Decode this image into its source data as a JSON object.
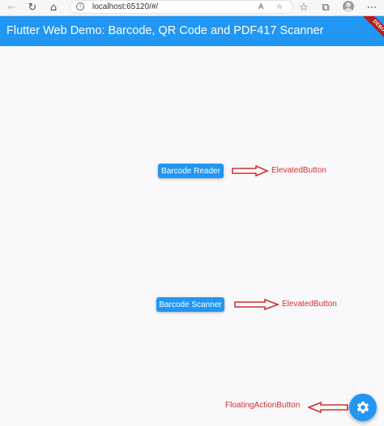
{
  "browser": {
    "back_icon": "←",
    "reload_icon": "↻",
    "home_icon": "⌂",
    "url": "localhost:65120/#/",
    "read_aloud_icon": "A",
    "star_icon": "☆",
    "favorites_icon": "☆",
    "collections_icon": "⧉"
  },
  "app_bar": {
    "title": "Flutter Web Demo: Barcode, QR Code and PDF417 Scanner",
    "debug_banner": "DEBUG",
    "color": "#2196f3"
  },
  "buttons": {
    "barcode_reader": "Barcode Reader",
    "barcode_scanner": "Barcode Scanner"
  },
  "annotations": {
    "reader_label": "ElevatedButton",
    "scanner_label": "ElevatedButton",
    "fab_label": "FloatingActionButton",
    "color": "#d32f2f"
  },
  "fab": {
    "icon": "settings-icon"
  }
}
